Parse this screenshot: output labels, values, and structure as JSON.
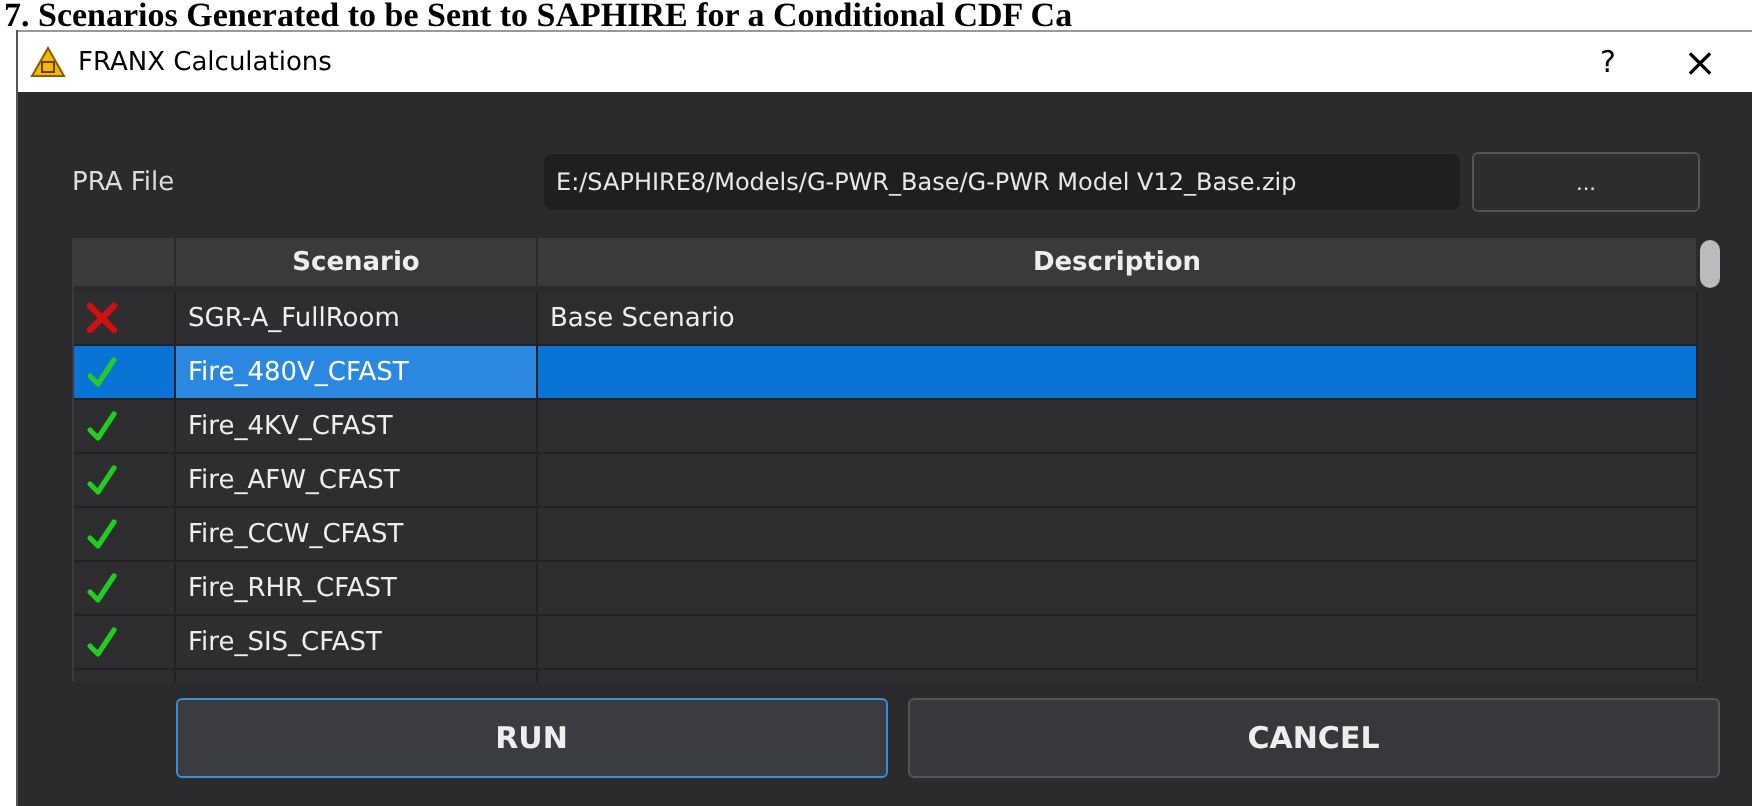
{
  "caption": "7. Scenarios Generated  to be Sent to SAPHIRE for a Conditional CDF Ca",
  "window": {
    "title": "FRANX Calculations",
    "help": "?",
    "close": "×"
  },
  "pra_file": {
    "label": "PRA File",
    "value": "E:/SAPHIRE8/Models/G-PWR_Base/G-PWR Model V12_Base.zip",
    "browse": "..."
  },
  "table": {
    "columns": [
      "Scenario",
      "Description"
    ],
    "rows": [
      {
        "kind": "fail",
        "scenario": "SGR-A_FullRoom",
        "description": "Base Scenario",
        "selected": false
      },
      {
        "kind": "pass",
        "scenario": "Fire_480V_CFAST",
        "selected": true
      },
      {
        "kind": "pass",
        "scenario": "Fire_4KV_CFAST",
        "selected": false
      },
      {
        "kind": "pass",
        "scenario": "Fire_AFW_CFAST",
        "selected": false
      },
      {
        "kind": "pass",
        "scenario": "Fire_CCW_CFAST",
        "selected": false
      },
      {
        "kind": "pass",
        "scenario": "Fire_RHR_CFAST",
        "selected": false
      },
      {
        "kind": "pass",
        "scenario": "Fire_SIS_CFAST",
        "selected": false
      }
    ]
  },
  "buttons": [
    "RUN",
    "CANCEL"
  ]
}
